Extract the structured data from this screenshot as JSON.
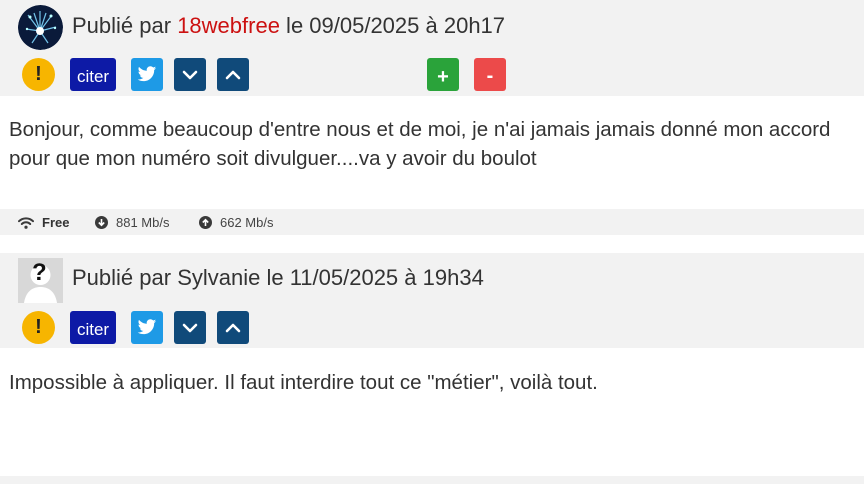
{
  "posts": [
    {
      "byline_prefix": "Publié par ",
      "author": "18webfree",
      "byline_suffix": " le 09/05/2025 à 20h17",
      "actions": {
        "alert_label": "!",
        "cite_label": "citer",
        "plus_label": "+",
        "minus_label": "-"
      },
      "body": "Bonjour, comme beaucoup d'entre nous et de moi, je n'ai jamais jamais donné mon accord pour que mon numéro soit divulguer....va y avoir du boulot",
      "connection": {
        "isp": "Free",
        "download": "881 Mb/s",
        "upload": "662 Mb/s"
      }
    },
    {
      "byline_prefix": "Publié par ",
      "author": "Sylvanie",
      "byline_suffix": " le 11/05/2025 à 19h34",
      "avatar_placeholder": "?",
      "actions": {
        "alert_label": "!",
        "cite_label": "citer"
      },
      "body": "Impossible à appliquer. Il faut interdire tout ce \"métier\", voilà tout."
    }
  ],
  "colors": {
    "author_link": "#cc1111",
    "alert": "#f7b500",
    "cite": "#0d1aa6",
    "twitter": "#1e9ae6",
    "nav": "#104a7a",
    "plus": "#2aa33a",
    "minus": "#ec4a4a",
    "header_bg": "#f2f2f2"
  },
  "icons": {
    "avatar1": "fireworks-avatar-icon",
    "avatar2": "question-avatar-icon",
    "twitter": "twitter-bird-icon",
    "down": "chevron-down-icon",
    "up": "chevron-up-icon",
    "wifi": "wifi-icon",
    "download": "download-arrow-icon",
    "upload": "upload-arrow-icon"
  }
}
